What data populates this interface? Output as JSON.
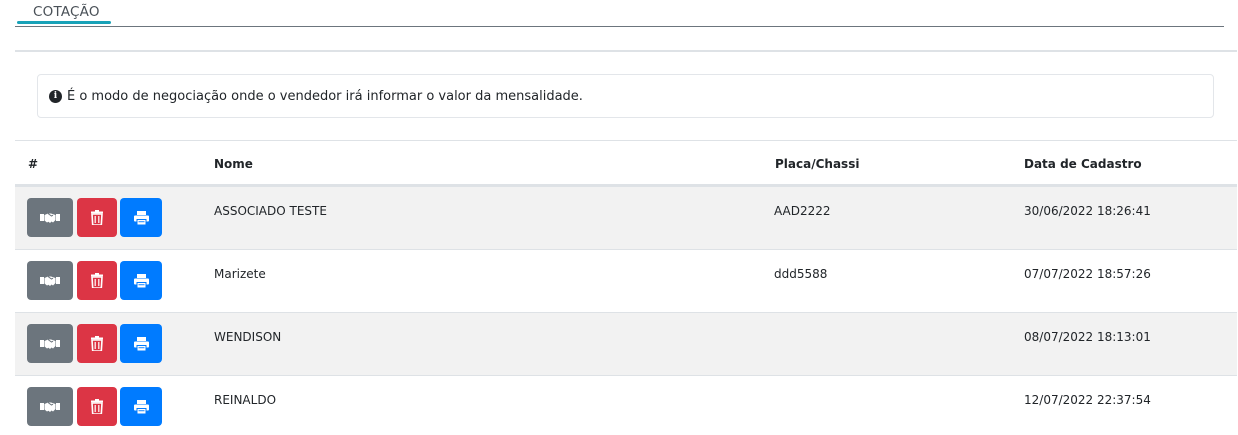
{
  "tab": {
    "label": "COTAÇÃO"
  },
  "info": {
    "text": "É o modo de negociação onde o vendedor irá informar o valor da mensalidade."
  },
  "table": {
    "headers": {
      "hash": "#",
      "name": "Nome",
      "plate": "Placa/Chassi",
      "date": "Data de Cadastro"
    },
    "rows": [
      {
        "name": "ASSOCIADO TESTE",
        "plate": "AAD2222",
        "date": "30/06/2022 18:26:41"
      },
      {
        "name": "Marizete",
        "plate": "ddd5588",
        "date": "07/07/2022 18:57:26"
      },
      {
        "name": "WENDISON",
        "plate": "",
        "date": "08/07/2022 18:13:01"
      },
      {
        "name": "REINALDO",
        "plate": "",
        "date": "12/07/2022 22:37:54"
      }
    ],
    "row_actions": [
      "handshake-icon",
      "trash-icon",
      "print-icon"
    ]
  },
  "colors": {
    "accent": "#17a2b8",
    "gray": "#6c757d",
    "red": "#dc3545",
    "blue": "#007bff"
  }
}
